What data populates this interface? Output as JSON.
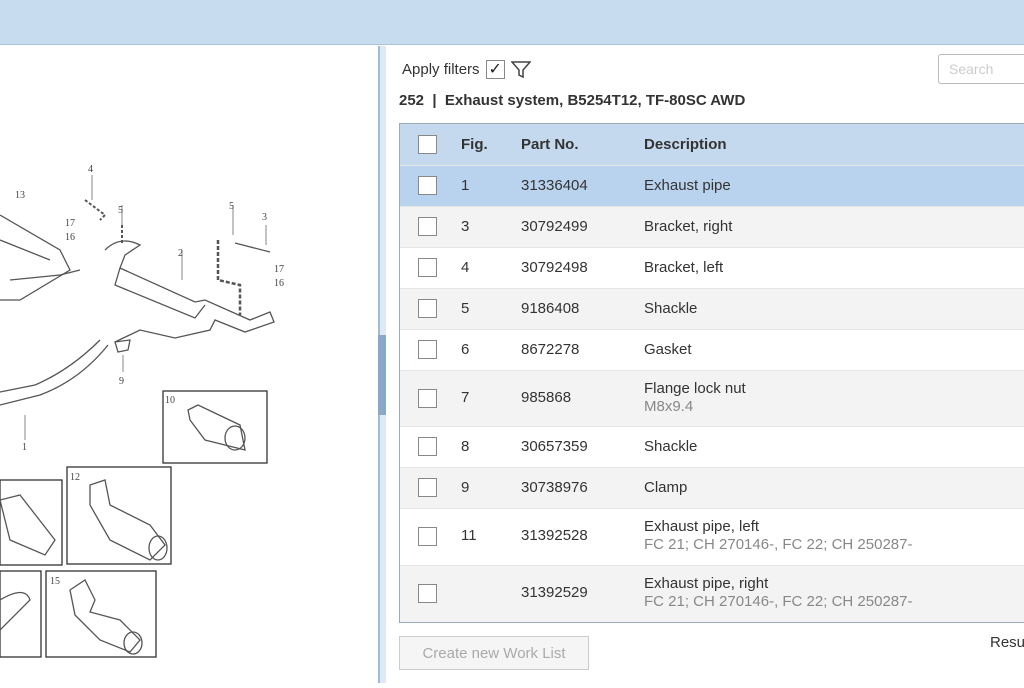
{
  "filters": {
    "label": "Apply filters",
    "checked": true,
    "filter_icon": "funnel-icon"
  },
  "search": {
    "placeholder": "Search"
  },
  "title": "252  |  Exhaust system, B5254T12, TF-80SC AWD",
  "table": {
    "headers": {
      "fig": "Fig.",
      "part_no": "Part No.",
      "description": "Description"
    },
    "rows": [
      {
        "fig": "1",
        "part_no": "31336404",
        "description": "Exhaust pipe",
        "note": "",
        "selected": true
      },
      {
        "fig": "3",
        "part_no": "30792499",
        "description": "Bracket, right",
        "note": ""
      },
      {
        "fig": "4",
        "part_no": "30792498",
        "description": "Bracket, left",
        "note": ""
      },
      {
        "fig": "5",
        "part_no": "9186408",
        "description": "Shackle",
        "note": ""
      },
      {
        "fig": "6",
        "part_no": "8672278",
        "description": "Gasket",
        "note": ""
      },
      {
        "fig": "7",
        "part_no": "985868",
        "description": "Flange lock nut",
        "note": "M8x9.4"
      },
      {
        "fig": "8",
        "part_no": "30657359",
        "description": "Shackle",
        "note": ""
      },
      {
        "fig": "9",
        "part_no": "30738976",
        "description": "Clamp",
        "note": ""
      },
      {
        "fig": "11",
        "part_no": "31392528",
        "description": "Exhaust pipe, left",
        "note": "FC 21; CH 270146-, FC 22; CH 250287-"
      },
      {
        "fig": "",
        "part_no": "31392529",
        "description": "Exhaust pipe, right",
        "note": "FC 21; CH 270146-, FC 22; CH 250287-"
      }
    ]
  },
  "buttons": {
    "create_work_list": "Create new Work List"
  },
  "results_label": "Resu",
  "diagram": {
    "labels": [
      "13",
      "4",
      "5",
      "17",
      "16",
      "5",
      "3",
      "2",
      "17",
      "16",
      "9",
      "1",
      "10",
      "12",
      "15"
    ]
  },
  "colors": {
    "topbar": "#c8dcf0",
    "selected_row": "#b9d3ee",
    "header": "#c5d9ee"
  }
}
